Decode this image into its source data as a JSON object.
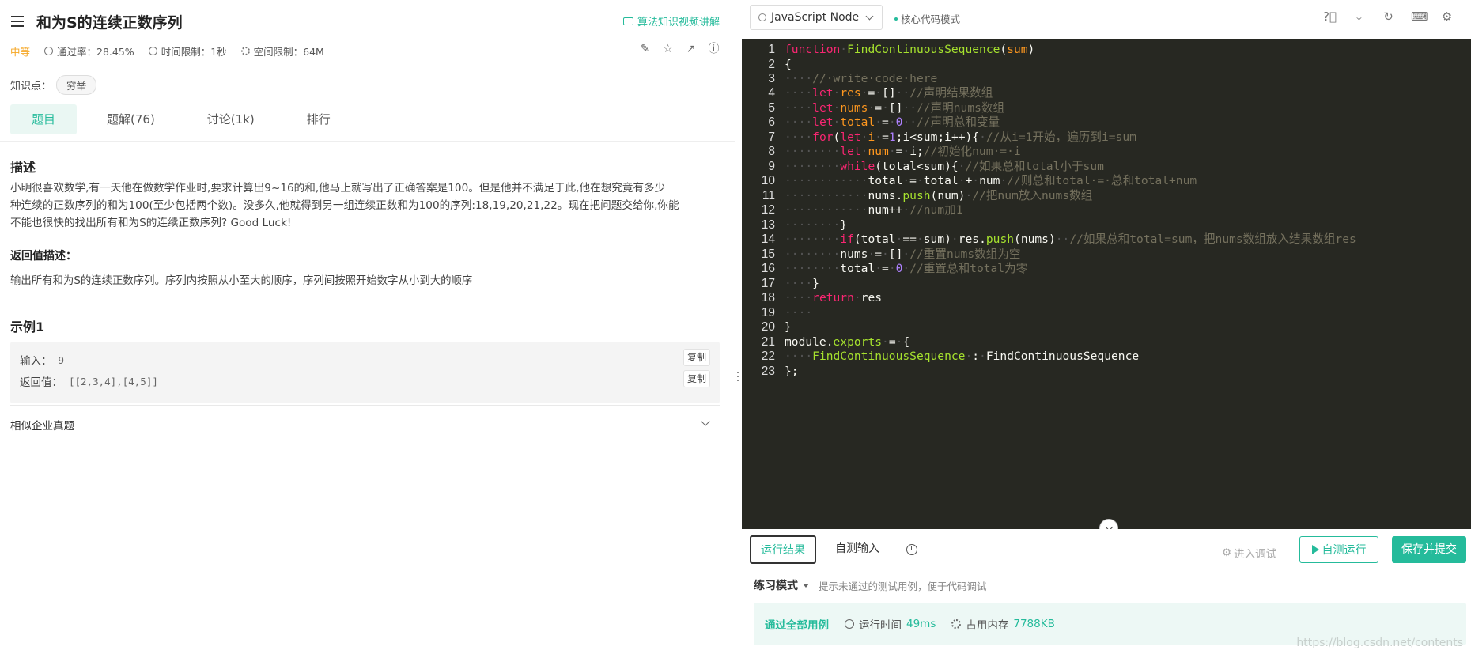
{
  "problem": {
    "title": "和为S的连续正数序列",
    "video_link": "算法知识视频讲解",
    "difficulty": "中等",
    "pass_rate": "通过率：28.45%",
    "time_limit": "时间限制：1秒",
    "space_limit": "空间限制：64M",
    "knowledge_label": "知识点：",
    "tag": "穷举",
    "tabs": [
      {
        "label": "题目"
      },
      {
        "label": "题解(76)"
      },
      {
        "label": "讨论(1k)"
      },
      {
        "label": "排行"
      }
    ],
    "desc_heading": "描述",
    "desc_line1": "小明很喜欢数学,有一天他在做数学作业时,要求计算出9~16的和,他马上就写出了正确答案是100。但是他并不满足于此,他在想究竟有多少",
    "desc_line2": "种连续的正数序列的和为100(至少包括两个数)。没多久,他就得到另一组连续正数和为100的序列:18,19,20,21,22。现在把问题交给你,你能",
    "desc_line3": "不能也很快的找出所有和为S的连续正数序列? Good Luck!",
    "return_heading": "返回值描述：",
    "return_desc": "输出所有和为S的连续正数序列。序列内按照从小至大的顺序，序列间按照开始数字从小到大的顺序",
    "example_heading": "示例1",
    "example_input_label": "输入：",
    "example_input_value": "9",
    "example_output_label": "返回值：",
    "example_output_value": "[[2,3,4],[4,5]]",
    "copy_label": "复制",
    "similar_label": "相似企业真题"
  },
  "editor": {
    "language": "JavaScript Node",
    "mode": "核心代码模式",
    "toolbar_icons": [
      "help-icon",
      "download-icon",
      "refresh-icon",
      "keyboard-icon",
      "settings-icon"
    ],
    "line_numbers": [
      "1",
      "2",
      "3",
      "4",
      "5",
      "6",
      "7",
      "8",
      "9",
      "10",
      "11",
      "12",
      "13",
      "14",
      "15",
      "16",
      "17",
      "18",
      "19",
      "20",
      "21",
      "22",
      "23"
    ]
  },
  "result": {
    "tab_result": "运行结果",
    "tab_input": "自测输入",
    "debug_label": "进入调试",
    "run_label": "自测运行",
    "submit_label": "保存并提交",
    "mode_label": "练习模式",
    "mode_hint": "提示未通过的测试用例，便于代码调试",
    "pass_label": "通过全部用例",
    "runtime_label": "运行时间",
    "runtime_value": "49ms",
    "memory_label": "占用内存",
    "memory_value": "7788KB"
  },
  "watermark": "https://blog.csdn.net/contents",
  "colors": {
    "accent": "#25bb9b",
    "difficulty_medium": "#f5a623",
    "editor_bg": "#272822"
  }
}
